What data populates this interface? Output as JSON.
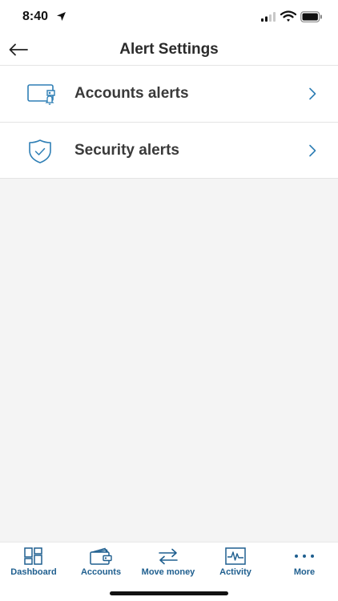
{
  "status": {
    "time": "8:40"
  },
  "header": {
    "title": "Alert Settings",
    "back_icon": "arrow-left-icon"
  },
  "alerts": [
    {
      "label": "Accounts alerts",
      "icon": "wallet-bell-icon"
    },
    {
      "label": "Security alerts",
      "icon": "shield-check-icon"
    }
  ],
  "nav": [
    {
      "label": "Dashboard",
      "icon": "dashboard-icon"
    },
    {
      "label": "Accounts",
      "icon": "wallet-icon"
    },
    {
      "label": "Move money",
      "icon": "transfer-arrows-icon"
    },
    {
      "label": "Activity",
      "icon": "activity-icon"
    },
    {
      "label": "More",
      "icon": "more-dots-icon"
    }
  ],
  "colors": {
    "accent": "#1f5f8f",
    "icon_blue": "#2f7fb5",
    "background": "#f4f4f4"
  }
}
